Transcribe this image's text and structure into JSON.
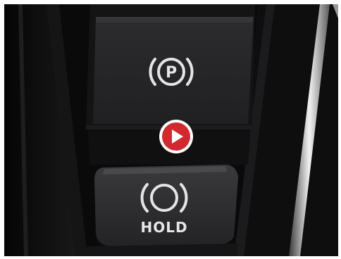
{
  "console": {
    "parking_brake": {
      "symbol": "P",
      "icon": "parking-brake-icon"
    },
    "auto_hold": {
      "label": "HOLD",
      "icon": "auto-hold-icon"
    }
  },
  "player": {
    "icon": "play-icon",
    "color": "#d3282e"
  }
}
